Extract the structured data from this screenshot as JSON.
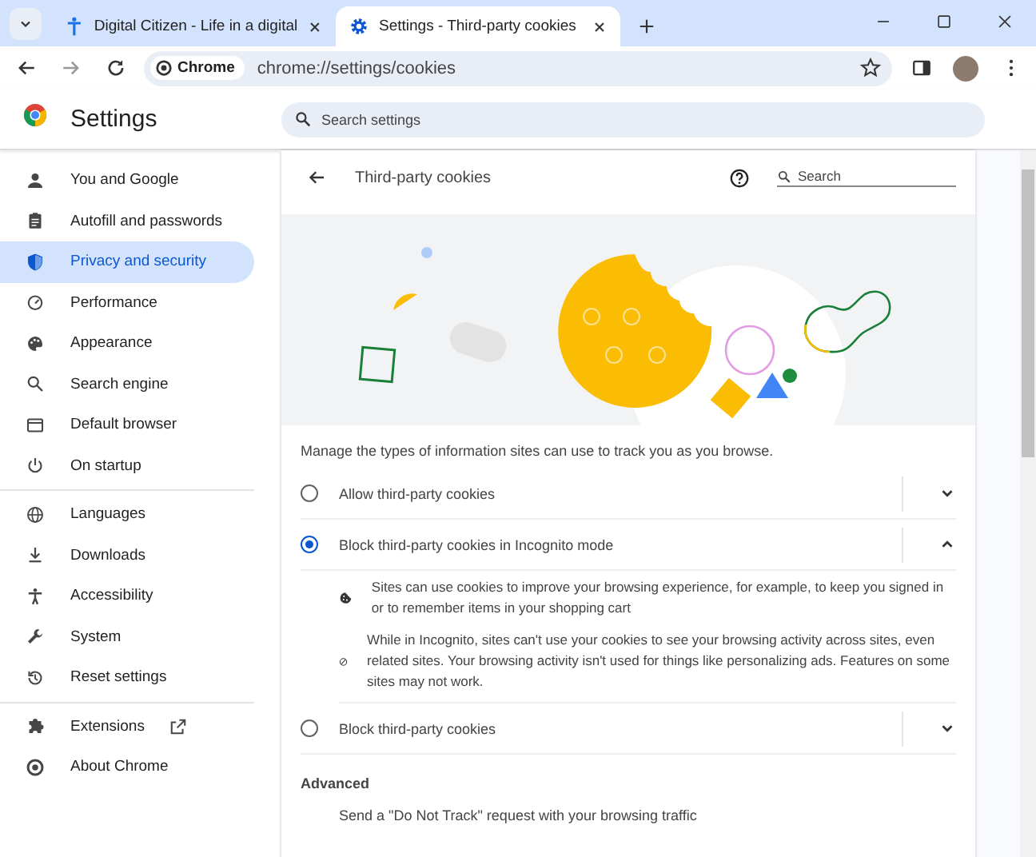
{
  "tabs": [
    {
      "title": "Digital Citizen - Life in a digital",
      "selected": false
    },
    {
      "title": "Settings - Third-party cookies",
      "selected": true
    }
  ],
  "address_bar": {
    "chip": "Chrome",
    "url": "chrome://settings/cookies"
  },
  "header": {
    "title": "Settings",
    "search_placeholder": "Search settings"
  },
  "sidebar": {
    "groups": [
      {
        "items": [
          {
            "label": "You and Google",
            "selected": false,
            "external": false
          },
          {
            "label": "Autofill and passwords",
            "selected": false,
            "external": false
          },
          {
            "label": "Privacy and security",
            "selected": true,
            "external": false
          },
          {
            "label": "Performance",
            "selected": false,
            "external": false
          },
          {
            "label": "Appearance",
            "selected": false,
            "external": false
          },
          {
            "label": "Search engine",
            "selected": false,
            "external": false
          },
          {
            "label": "Default browser",
            "selected": false,
            "external": false
          },
          {
            "label": "On startup",
            "selected": false,
            "external": false
          }
        ]
      },
      {
        "items": [
          {
            "label": "Languages",
            "selected": false,
            "external": false
          },
          {
            "label": "Downloads",
            "selected": false,
            "external": false
          },
          {
            "label": "Accessibility",
            "selected": false,
            "external": false
          },
          {
            "label": "System",
            "selected": false,
            "external": false
          },
          {
            "label": "Reset settings",
            "selected": false,
            "external": false
          }
        ]
      },
      {
        "items": [
          {
            "label": "Extensions",
            "selected": false,
            "external": true
          },
          {
            "label": "About Chrome",
            "selected": false,
            "external": false
          }
        ]
      }
    ]
  },
  "page": {
    "title": "Third-party cookies",
    "search_placeholder": "Search",
    "description": "Manage the types of information sites can use to track you as you browse.",
    "options": [
      {
        "label": "Allow third-party cookies",
        "selected": false,
        "expanded": false
      },
      {
        "label": "Block third-party cookies in Incognito mode",
        "selected": true,
        "expanded": true,
        "details": [
          {
            "kind": "cookie",
            "text": "Sites can use cookies to improve your browsing experience, for example, to keep you signed in or to remember items in your shopping cart"
          },
          {
            "kind": "block",
            "text": "While in Incognito, sites can't use your cookies to see your browsing activity across sites, even related sites. Your browsing activity isn't used for things like personalizing ads. Features on some sites may not work."
          }
        ]
      },
      {
        "label": "Block third-party cookies",
        "selected": false,
        "expanded": false
      }
    ],
    "advanced_heading": "Advanced",
    "advanced_items": [
      "Send a \"Do Not Track\" request with your browsing traffic"
    ]
  }
}
